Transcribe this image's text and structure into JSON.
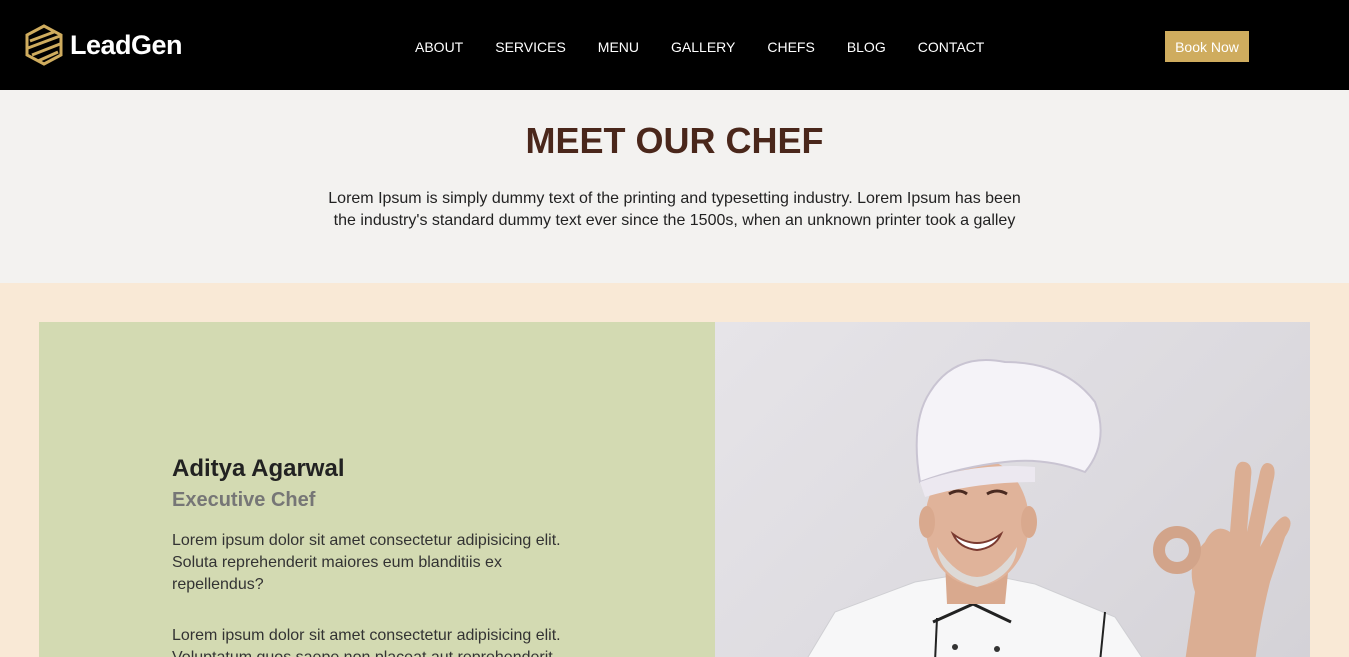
{
  "brand": {
    "name": "LeadGen",
    "accent": "#cfac5e"
  },
  "nav": {
    "items": [
      "ABOUT",
      "SERVICES",
      "MENU",
      "GALLERY",
      "CHEFS",
      "BLOG",
      "CONTACT"
    ],
    "cta_label": "Book Now"
  },
  "intro": {
    "title": "MEET OUR CHEF",
    "text": "Lorem Ipsum is simply dummy text of the printing and typesetting industry. Lorem Ipsum has been the industry's standard dummy text ever since the 1500s, when an unknown printer took a galley"
  },
  "chef": {
    "name": "Aditya Agarwal",
    "role": "Executive Chef",
    "paragraph_1": "Lorem ipsum dolor sit amet consectetur adipisicing elit. Soluta reprehenderit maiores eum blanditiis ex repellendus?",
    "paragraph_2": "Lorem ipsum dolor sit amet consectetur adipisicing elit. Voluptatum quos saepe non placeat aut reprehenderit",
    "photo_icon": "chef-portrait"
  },
  "colors": {
    "header_bg": "#000000",
    "title_color": "#4a271b",
    "card_bg": "#d3dab2",
    "section_bg": "#f9e9d6"
  }
}
